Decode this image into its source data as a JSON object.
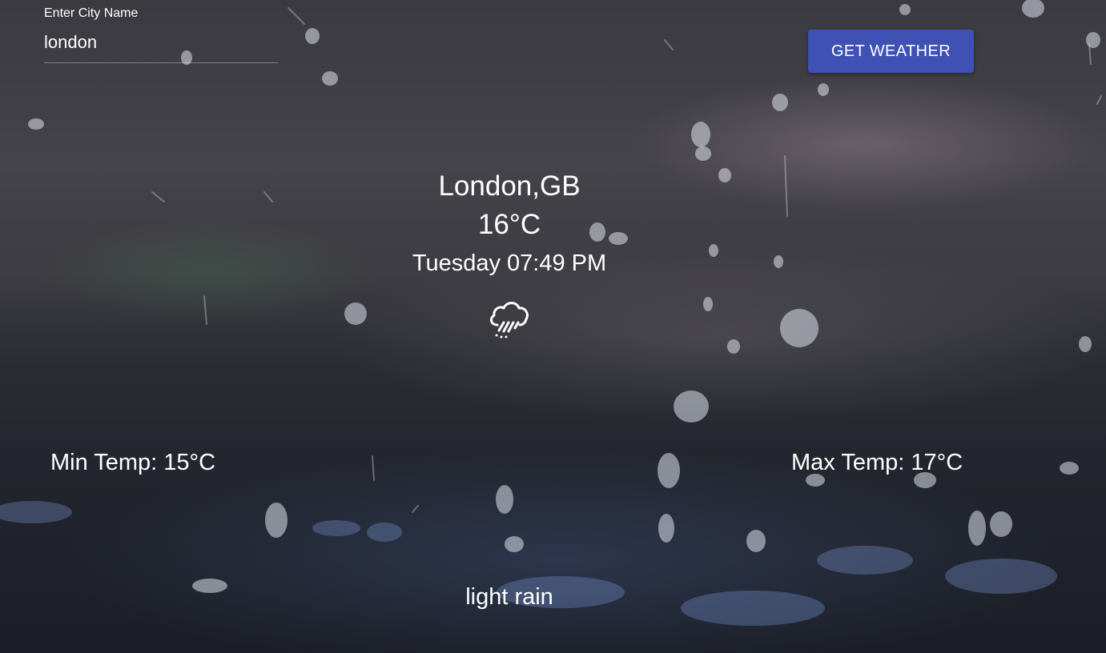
{
  "search": {
    "label": "Enter City Name",
    "value": "london"
  },
  "button": {
    "label": "GET WEATHER",
    "color": "#3f51b5"
  },
  "weather": {
    "location": "London,GB",
    "temperature": "16°C",
    "datetime": "Tuesday 07:49 PM",
    "icon": "rain-cloud-icon",
    "min_temp": "Min Temp: 15°C",
    "max_temp": "Max Temp: 17°C",
    "description": "light rain"
  }
}
